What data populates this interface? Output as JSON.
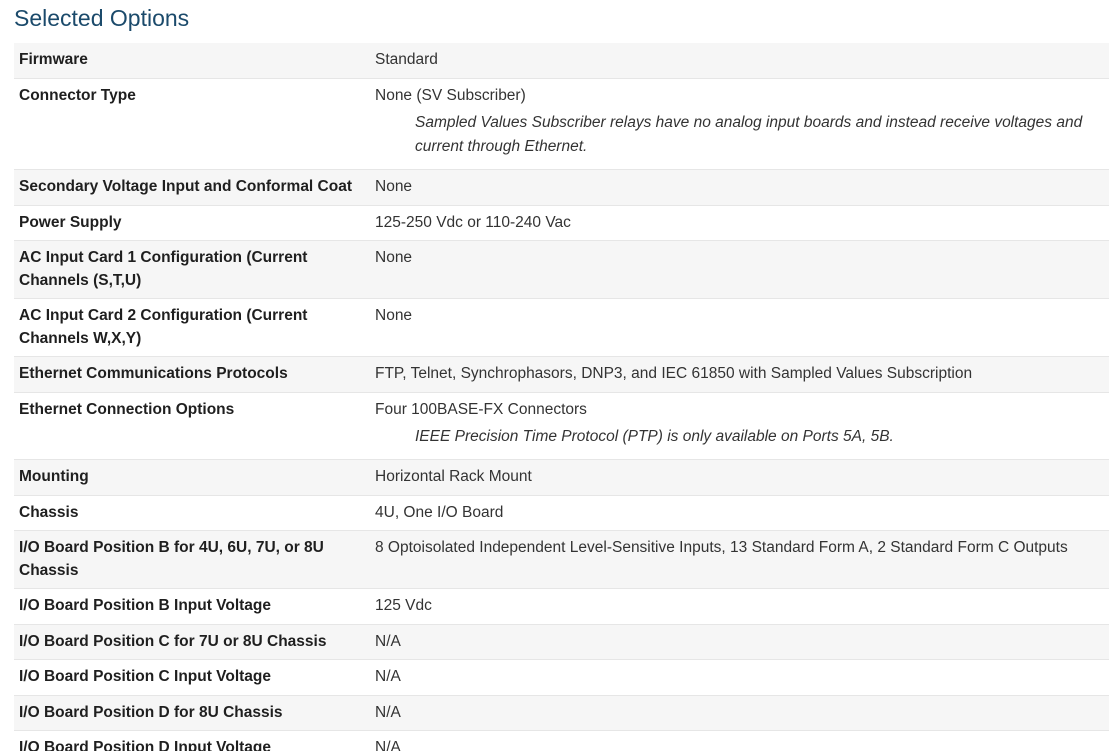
{
  "title": "Selected Options",
  "rows": [
    {
      "label": "Firmware",
      "value": "Standard",
      "note": ""
    },
    {
      "label": "Connector Type",
      "value": "None (SV Subscriber)",
      "note": "Sampled Values Subscriber relays have no analog input boards and instead receive voltages and current through Ethernet."
    },
    {
      "label": "Secondary Voltage Input and Conformal Coat",
      "value": "None",
      "note": ""
    },
    {
      "label": "Power Supply",
      "value": "125-250 Vdc or 110-240 Vac",
      "note": ""
    },
    {
      "label": "AC Input Card 1 Configuration (Current Channels (S,T,U)",
      "value": "None",
      "note": ""
    },
    {
      "label": "AC Input Card 2 Configuration (Current Channels W,X,Y)",
      "value": "None",
      "note": ""
    },
    {
      "label": "Ethernet Communications Protocols",
      "value": "FTP, Telnet, Synchrophasors, DNP3, and IEC 61850 with Sampled Values Subscription",
      "note": ""
    },
    {
      "label": "Ethernet Connection Options",
      "value": "Four 100BASE-FX Connectors",
      "note": "IEEE Precision Time Protocol (PTP) is only available on Ports 5A, 5B."
    },
    {
      "label": "Mounting",
      "value": "Horizontal Rack Mount",
      "note": ""
    },
    {
      "label": "Chassis",
      "value": "4U, One I/O Board",
      "note": ""
    },
    {
      "label": "I/O Board Position B for 4U, 6U, 7U, or 8U Chassis",
      "value": "8 Optoisolated Independent Level-Sensitive Inputs, 13 Standard Form A, 2 Standard Form C Outputs",
      "note": ""
    },
    {
      "label": "I/O Board Position B Input Voltage",
      "value": "125 Vdc",
      "note": ""
    },
    {
      "label": "I/O Board Position C for 7U or 8U Chassis",
      "value": "N/A",
      "note": ""
    },
    {
      "label": "I/O Board Position C Input Voltage",
      "value": "N/A",
      "note": ""
    },
    {
      "label": "I/O Board Position D for 8U Chassis",
      "value": "N/A",
      "note": ""
    },
    {
      "label": "I/O Board Position D Input Voltage",
      "value": "N/A",
      "note": ""
    }
  ]
}
